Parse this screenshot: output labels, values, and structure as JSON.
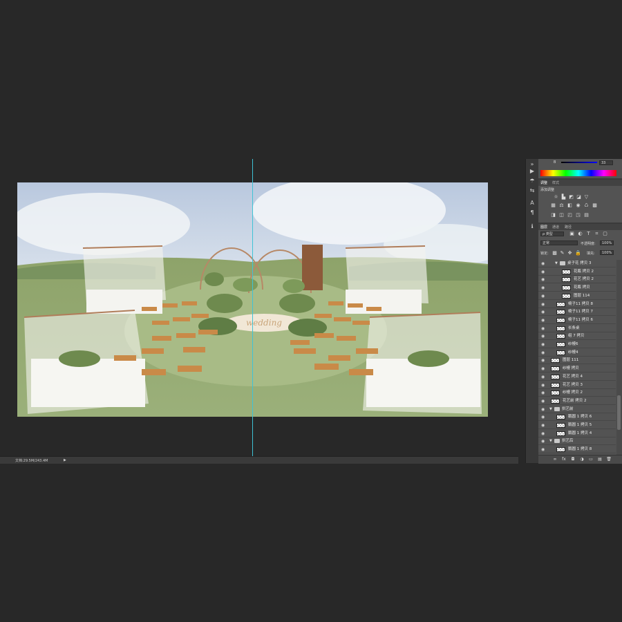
{
  "status_bar": {
    "doc_info": "文档:29.5M/243.4M",
    "arrow": "▶"
  },
  "color_panel": {
    "channel": "B",
    "value": "33"
  },
  "adjust_panel": {
    "tabs": [
      "调整",
      "样式"
    ],
    "title": "添加调整"
  },
  "layers_panel": {
    "tabs": [
      "图层",
      "通道",
      "路径"
    ],
    "filter_label": "ρ 类型",
    "blend_mode": "正常",
    "opacity_label": "不透明度:",
    "opacity_value": "100%",
    "lock_label": "锁定:",
    "fill_label": "填充:",
    "fill_value": "100%",
    "layers": [
      {
        "name": "桌子花 拷贝 3",
        "kind": "group",
        "open": true,
        "indent": 2
      },
      {
        "name": "花瓶 拷贝 2",
        "kind": "layer",
        "indent": 3
      },
      {
        "name": "花艺 拷贝 2",
        "kind": "layer",
        "indent": 3
      },
      {
        "name": "花瓶 拷贝",
        "kind": "layer",
        "indent": 3
      },
      {
        "name": "图层 114",
        "kind": "layer",
        "indent": 3
      },
      {
        "name": "椅子11 拷贝 8",
        "kind": "layer",
        "indent": 2
      },
      {
        "name": "椅子11 拷贝 7",
        "kind": "layer",
        "indent": 2
      },
      {
        "name": "椅子11 拷贝 6",
        "kind": "layer",
        "indent": 2
      },
      {
        "name": "长条桌",
        "kind": "layer",
        "indent": 2
      },
      {
        "name": "组 7 拷贝",
        "kind": "layer",
        "indent": 2
      },
      {
        "name": "纱幔6",
        "kind": "layer",
        "indent": 2
      },
      {
        "name": "纱幔4",
        "kind": "layer",
        "indent": 2
      },
      {
        "name": "图层 111",
        "kind": "layer",
        "indent": 1
      },
      {
        "name": "纱幔 拷贝",
        "kind": "layer",
        "indent": 1
      },
      {
        "name": "花艺 拷贝 4",
        "kind": "layer",
        "indent": 1
      },
      {
        "name": "花艺 拷贝 3",
        "kind": "layer",
        "indent": 1
      },
      {
        "name": "纱幔 拷贝 2",
        "kind": "layer",
        "indent": 1
      },
      {
        "name": "花艺前 拷贝 2",
        "kind": "layer",
        "indent": 1
      },
      {
        "name": "拱艺前",
        "kind": "group",
        "open": true,
        "indent": 1
      },
      {
        "name": "鹅圆 1 拷贝 6",
        "kind": "layer",
        "indent": 2
      },
      {
        "name": "鹅圆 1 拷贝 5",
        "kind": "layer",
        "indent": 2
      },
      {
        "name": "鹅圆 1 拷贝 4",
        "kind": "layer",
        "indent": 2
      },
      {
        "name": "拱艺后",
        "kind": "group",
        "open": true,
        "indent": 1
      },
      {
        "name": "鹅圆 1 拷贝 8",
        "kind": "layer",
        "indent": 2
      }
    ]
  },
  "canvas": {
    "sign_text": "wedding"
  }
}
